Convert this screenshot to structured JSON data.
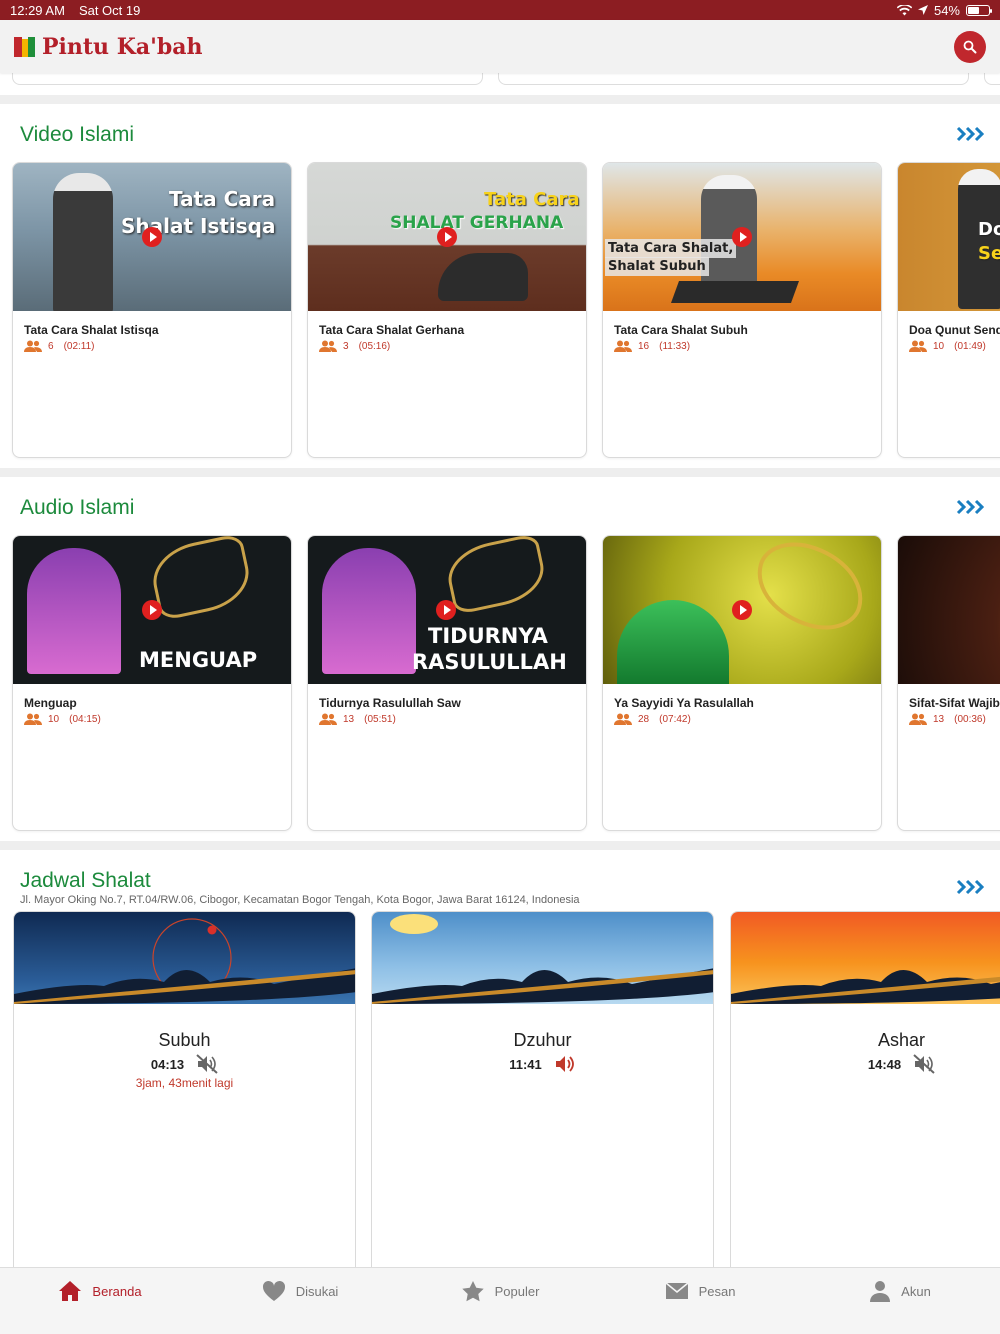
{
  "status": {
    "time": "12:29 AM",
    "date": "Sat Oct 19",
    "battery": "54%"
  },
  "app": {
    "title": "Pintu Ka'bah"
  },
  "colors": {
    "brand": "#b3202a",
    "green": "#1c8a3c",
    "accent_blue": "#1a7fc1"
  },
  "video": {
    "title": "Video Islami",
    "items": [
      {
        "title": "Tata Cara Shalat Istisqa",
        "views": "6",
        "duration": "(02:11)",
        "thumb_text": [
          "Tata Cara",
          "Shalat Istisqa"
        ]
      },
      {
        "title": "Tata Cara Shalat Gerhana",
        "views": "3",
        "duration": "(05:16)",
        "thumb_text": [
          "Tata Cara",
          "SHALAT GERHANA"
        ]
      },
      {
        "title": "Tata Cara Shalat Subuh",
        "views": "16",
        "duration": "(11:33)",
        "thumb_text": [
          "Tata Cara Shalat,",
          "Shalat Subuh"
        ]
      },
      {
        "title": "Doa Qunut Send",
        "views": "10",
        "duration": "(01:49)",
        "thumb_text": [
          "Do",
          "Se"
        ]
      }
    ]
  },
  "audio": {
    "title": "Audio Islami",
    "items": [
      {
        "title": "Menguap",
        "views": "10",
        "duration": "(04:15)",
        "thumb_text": [
          "MENGUAP"
        ]
      },
      {
        "title": "Tidurnya Rasulullah Saw",
        "views": "13",
        "duration": "(05:51)",
        "thumb_text": [
          "TIDURNYA",
          "RASULULLAH"
        ]
      },
      {
        "title": "Ya Sayyidi Ya Rasulallah",
        "views": "28",
        "duration": "(07:42)",
        "thumb_text": []
      },
      {
        "title": "Sifat-Sifat Wajib",
        "views": "13",
        "duration": "(00:36)",
        "thumb_text": []
      }
    ]
  },
  "jadwal": {
    "title": "Jadwal Shalat",
    "address": "Jl. Mayor Oking No.7, RT.04/RW.06, Cibogor, Kecamatan Bogor Tengah, Kota Bogor, Jawa Barat 16124, Indonesia",
    "items": [
      {
        "name": "Subuh",
        "time": "04:13",
        "sound": "muted",
        "remaining": "3jam, 43menit lagi"
      },
      {
        "name": "Dzuhur",
        "time": "11:41",
        "sound": "on",
        "remaining": ""
      },
      {
        "name": "Ashar",
        "time": "14:48",
        "sound": "muted",
        "remaining": ""
      }
    ]
  },
  "tabs": [
    {
      "label": "Beranda",
      "icon": "home-icon",
      "active": true
    },
    {
      "label": "Disukai",
      "icon": "heart-icon",
      "active": false
    },
    {
      "label": "Populer",
      "icon": "star-icon",
      "active": false
    },
    {
      "label": "Pesan",
      "icon": "mail-icon",
      "active": false
    },
    {
      "label": "Akun",
      "icon": "person-icon",
      "active": false
    }
  ]
}
